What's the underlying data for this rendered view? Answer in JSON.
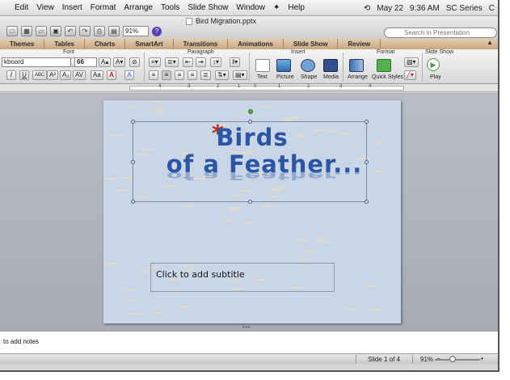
{
  "menubar": {
    "items": [
      "Edit",
      "View",
      "Insert",
      "Format",
      "Arrange",
      "Tools",
      "Slide Show",
      "Window",
      "Help"
    ],
    "script_icon": "applescript-icon",
    "date": "May 22",
    "time": "9:36 AM",
    "series": "SC Series",
    "trailing": "C"
  },
  "titlebar": {
    "doc_title": "Bird Migration.pptx",
    "zoom": "91%",
    "search_placeholder": "Search in Presentation"
  },
  "ribbon_tabs": [
    "Themes",
    "Tables",
    "Charts",
    "SmartArt",
    "Transitions",
    "Animations",
    "Slide Show",
    "Review"
  ],
  "ribbon": {
    "groups": {
      "font": "Font",
      "paragraph": "Paragraph",
      "insert": "Insert",
      "format": "Format",
      "slide_show": "Slide Show"
    },
    "font_name": "kboard",
    "font_size": "66",
    "buttons": {
      "text": "Text",
      "picture": "Picture",
      "shape": "Shape",
      "media": "Media",
      "arrange": "Arrange",
      "quick_styles": "Quick Styles",
      "play": "Play"
    },
    "format_buttons": [
      "I",
      "U",
      "ABC",
      "A²",
      "A₂",
      "AV",
      "Aa",
      "A",
      "A"
    ]
  },
  "ruler": {
    "numbers": [
      "4",
      "3",
      "2",
      "1",
      "0",
      "1",
      "2",
      "3",
      "4"
    ]
  },
  "slide": {
    "asterisk": "*",
    "title_line1": "Birds",
    "title_line2": "of a Feather...",
    "subtitle_placeholder": "Click to add subtitle"
  },
  "notes": {
    "placeholder": "to add notes"
  },
  "status": {
    "slide_count": "Slide 1 of 4",
    "zoom": "91%"
  }
}
